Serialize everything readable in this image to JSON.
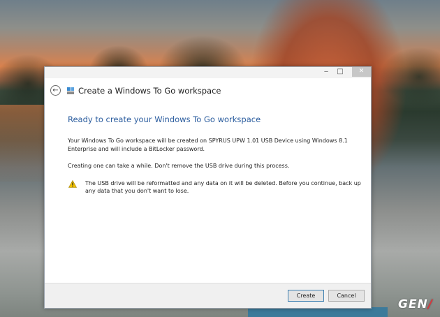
{
  "window": {
    "title": "Create a Windows To Go workspace",
    "caption": {
      "minimize": "‒",
      "maximize": "□",
      "close": "✕"
    }
  },
  "content": {
    "heading": "Ready to create your Windows To Go workspace",
    "para1": "Your Windows To Go workspace will be created on  SPYRUS UPW 1.01 USB Device using Windows 8.1 Enterprise and will include a BitLocker password.",
    "para2": "Creating one can take a while. Don't remove the USB drive during this process.",
    "warning": "The USB drive will be reformatted and any data on it will be deleted. Before you continue, back up any data that you don't want to lose."
  },
  "buttons": {
    "create": "Create",
    "cancel": "Cancel"
  },
  "watermark": {
    "text": "GEN",
    "accent": "∕"
  },
  "colors": {
    "heading": "#2a5c9e",
    "default_button_border": "#3c7fb1",
    "warning": "#f2c200"
  }
}
